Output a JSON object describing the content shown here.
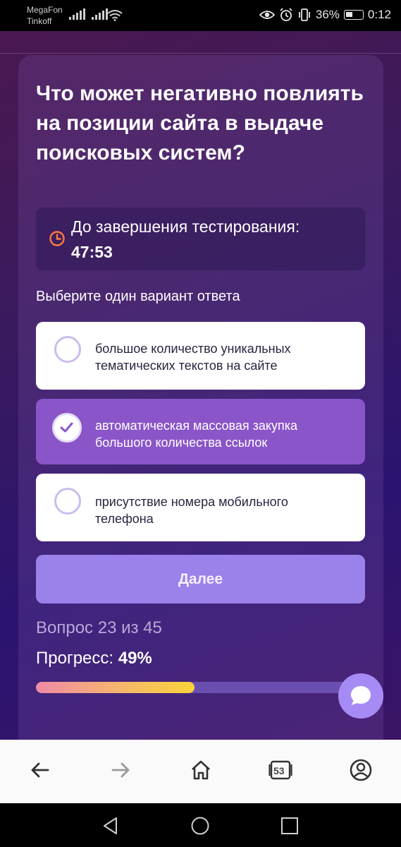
{
  "status_bar": {
    "carrier1": "MegaFon",
    "carrier2": "Tinkoff",
    "battery": "36%",
    "time": "0:12"
  },
  "quiz": {
    "question": "Что может негативно повлиять на позиции сайта в выдаче поисковых систем?",
    "timer_label": "До завершения тестирования:",
    "timer_value": "47:53",
    "hint": "Выберите один вариант ответа",
    "options": [
      {
        "text": "большое количество уникальных тематических текстов на сайте",
        "selected": false
      },
      {
        "text": "автоматическая массовая закупка большого количества ссылок",
        "selected": true
      },
      {
        "text": "присутствие номера мобильного телефона",
        "selected": false
      }
    ],
    "next_label": "Далее",
    "question_counter": "Вопрос 23 из 45",
    "progress_label": "Прогресс:",
    "progress_value": "49%",
    "progress_fraction": 0.49
  },
  "browser_bar": {
    "tabs_count": "53"
  },
  "colors": {
    "accent": "#9b82ea",
    "selected_option": "#8a55c8",
    "timer_icon": "#ff7a3d"
  }
}
